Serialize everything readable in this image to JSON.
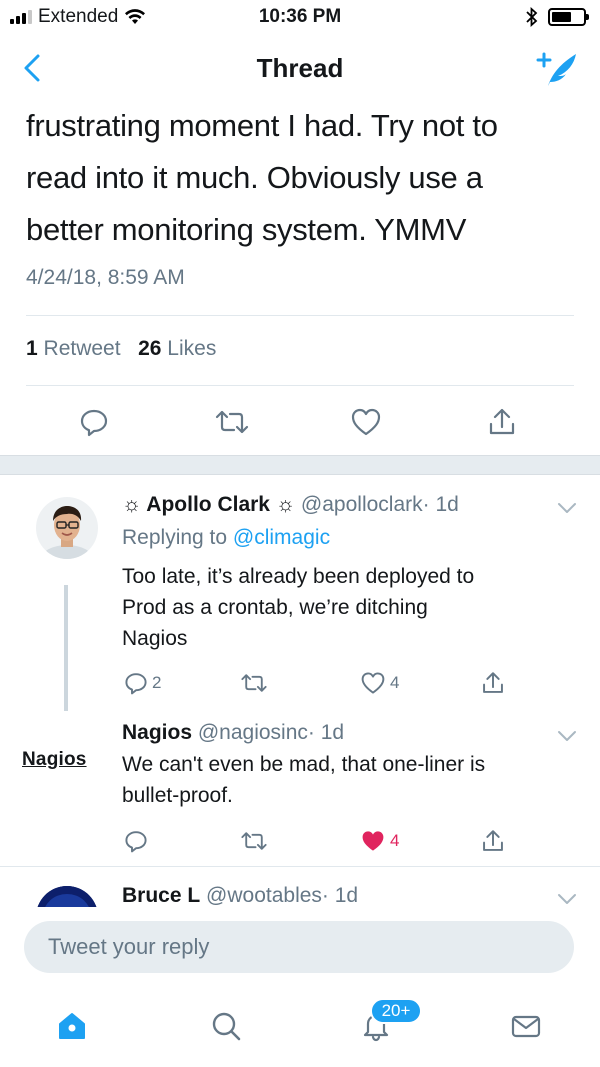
{
  "status_bar": {
    "carrier": "Extended",
    "time": "10:36 PM",
    "icons": [
      "signal-icon",
      "wifi-icon",
      "bluetooth-icon",
      "battery-icon"
    ]
  },
  "nav": {
    "title": "Thread",
    "back_icon": "chevron-left-icon",
    "compose_icon": "compose-tweet-icon"
  },
  "main_tweet": {
    "text_lines": [
      "frustrating moment I had. Try not to",
      "read into it much. Obviously use a",
      "better monitoring system. YMMV"
    ],
    "timestamp": "4/24/18, 8:59 AM",
    "retweet_count": "1",
    "retweet_label": "Retweet",
    "like_count": "26",
    "like_label": "Likes"
  },
  "replies": [
    {
      "name": "☼ Apollo Clark ☼",
      "handle": "@apolloclark",
      "time": "· 1d",
      "replying_prefix": "Replying to",
      "replying_to": "@climagic",
      "body_lines": [
        "Too late, it’s already been deployed to",
        "Prod as a crontab, we’re ditching",
        "Nagios"
      ],
      "reply_count": "2",
      "retweet_count": "",
      "like_count": "4",
      "liked": false
    },
    {
      "name": "Nagios",
      "handle": "@nagiosinc",
      "time": "· 1d",
      "logo_text": "Nagios",
      "body_lines": [
        "We can't even be mad, that one-liner is",
        "bullet-proof."
      ],
      "reply_count": "",
      "retweet_count": "",
      "like_count": "4",
      "liked": true
    },
    {
      "name": "Bruce L",
      "handle": "@wootables",
      "time": "· 1d"
    }
  ],
  "composer": {
    "placeholder": "Tweet your reply"
  },
  "tabbar": {
    "items": [
      "home-icon",
      "search-icon",
      "notifications-icon",
      "messages-icon"
    ],
    "notifications_badge": "20+"
  },
  "colors": {
    "accent": "#1da1f2",
    "like": "#e0245e",
    "muted": "#657786",
    "text": "#14171a",
    "divider": "#e1e8ed"
  }
}
